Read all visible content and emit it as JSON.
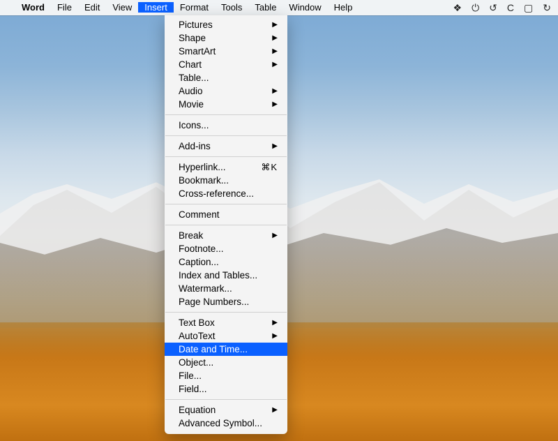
{
  "menubar": {
    "apple_glyph": "",
    "app_name": "Word",
    "items": [
      "File",
      "Edit",
      "View",
      "Insert",
      "Format",
      "Tools",
      "Table",
      "Window",
      "Help"
    ],
    "active_index": 3,
    "status_icons": [
      "dropbox",
      "power",
      "sync",
      "crescent",
      "airplay",
      "time-machine"
    ]
  },
  "dropdown": {
    "groups": [
      [
        {
          "label": "Pictures",
          "submenu": true
        },
        {
          "label": "Shape",
          "submenu": true
        },
        {
          "label": "SmartArt",
          "submenu": true
        },
        {
          "label": "Chart",
          "submenu": true
        },
        {
          "label": "Table...",
          "submenu": false
        },
        {
          "label": "Audio",
          "submenu": true
        },
        {
          "label": "Movie",
          "submenu": true
        }
      ],
      [
        {
          "label": "Icons...",
          "submenu": false
        }
      ],
      [
        {
          "label": "Add-ins",
          "submenu": true
        }
      ],
      [
        {
          "label": "Hyperlink...",
          "submenu": false,
          "shortcut": "⌘K"
        },
        {
          "label": "Bookmark...",
          "submenu": false
        },
        {
          "label": "Cross-reference...",
          "submenu": false
        }
      ],
      [
        {
          "label": "Comment",
          "submenu": false
        }
      ],
      [
        {
          "label": "Break",
          "submenu": true
        },
        {
          "label": "Footnote...",
          "submenu": false
        },
        {
          "label": "Caption...",
          "submenu": false
        },
        {
          "label": "Index and Tables...",
          "submenu": false
        },
        {
          "label": "Watermark...",
          "submenu": false
        },
        {
          "label": "Page Numbers...",
          "submenu": false
        }
      ],
      [
        {
          "label": "Text Box",
          "submenu": true
        },
        {
          "label": "AutoText",
          "submenu": true
        },
        {
          "label": "Date and Time...",
          "submenu": false,
          "highlight": true
        },
        {
          "label": "Object...",
          "submenu": false
        },
        {
          "label": "File...",
          "submenu": false
        },
        {
          "label": "Field...",
          "submenu": false
        }
      ],
      [
        {
          "label": "Equation",
          "submenu": true
        },
        {
          "label": "Advanced Symbol...",
          "submenu": false
        }
      ]
    ]
  }
}
